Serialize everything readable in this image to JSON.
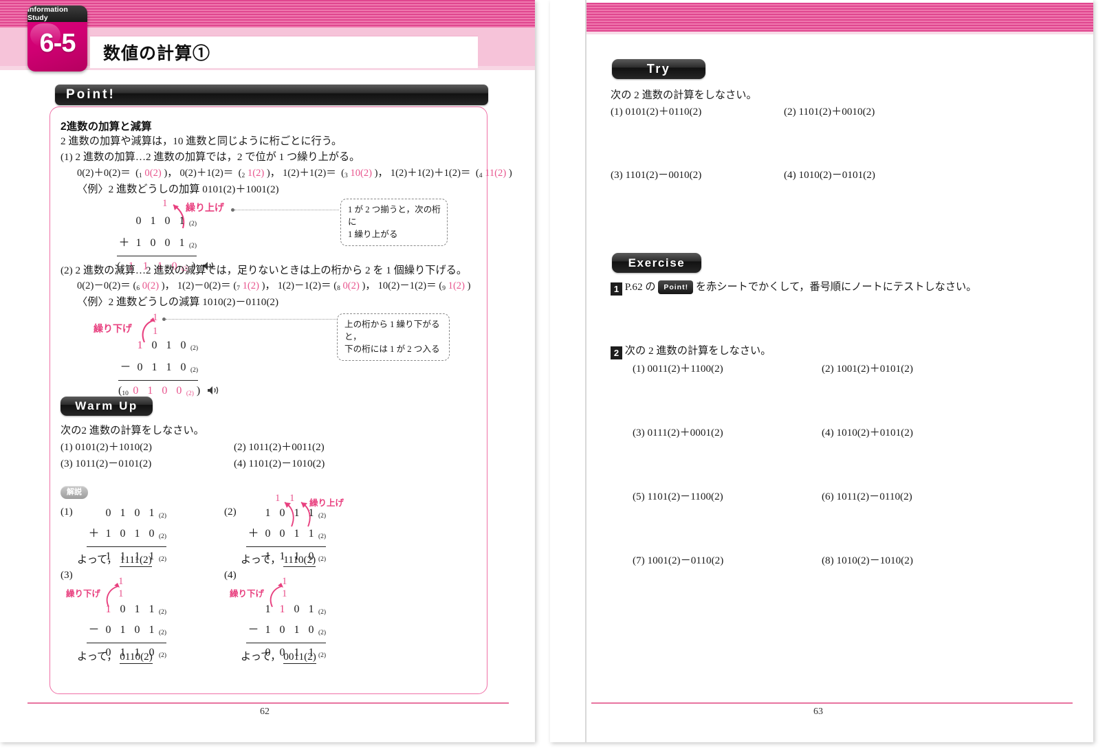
{
  "chapter": {
    "badge_label": "Information Study",
    "number": "6-5",
    "title": "数値の計算①"
  },
  "left_page": {
    "page_number": "62",
    "point_heading": "Point!",
    "point": {
      "section_title": "2進数の加算と減算",
      "intro": "2 進数の加算や減算は，10 進数と同じように桁ごとに行う。",
      "add": {
        "lead": "(1) 2 進数の加算…2 進数の加算では，2 で位が 1 つ繰り上がる。",
        "facts": [
          {
            "lhs": "0(2)＋0(2)＝",
            "blank_no": "1",
            "answer": "0(2)"
          },
          {
            "lhs": "0(2)＋1(2)＝",
            "blank_no": "2",
            "answer": "1(2)"
          },
          {
            "lhs": "1(2)＋1(2)＝",
            "blank_no": "3",
            "answer": "10(2)"
          },
          {
            "lhs": "1(2)＋1(2)＋1(2)＝",
            "blank_no": "4",
            "answer": "11(2)"
          }
        ],
        "example_label": "〈例〉2 進数どうしの加算 0101(2)＋1001(2)",
        "carry_label": "繰り上げ",
        "carry_mark": "1",
        "operand1": [
          "0",
          "1",
          "0",
          "1"
        ],
        "operand2": [
          "1",
          "0",
          "0",
          "1"
        ],
        "op_sign": "＋",
        "result_blank_no": "5",
        "result": [
          "1",
          "1",
          "1",
          "0"
        ],
        "callout": "1 が 2 つ揃うと，次の桁に\n1 繰り上がる"
      },
      "sub": {
        "lead": "(2) 2 進数の減算…2 進数の減算では，足りないときは上の桁から 2 を 1 個繰り下げる。",
        "facts": [
          {
            "lhs": "0(2)－0(2)＝",
            "blank_no": "6",
            "answer": "0(2)"
          },
          {
            "lhs": "1(2)－0(2)＝",
            "blank_no": "7",
            "answer": "1(2)"
          },
          {
            "lhs": "1(2)－1(2)＝",
            "blank_no": "8",
            "answer": "0(2)"
          },
          {
            "lhs": "10(2)－1(2)＝",
            "blank_no": "9",
            "answer": "1(2)"
          }
        ],
        "example_label": "〈例〉2 進数どうしの減算 1010(2)－0110(2)",
        "borrow_label": "繰り下げ",
        "borrow_marks": [
          "1",
          "1"
        ],
        "operand1": [
          "1",
          "0",
          "1",
          "0"
        ],
        "operand2": [
          "0",
          "1",
          "1",
          "0"
        ],
        "op_sign": "－",
        "result_blank_no": "10",
        "result": [
          "0",
          "1",
          "0",
          "0"
        ],
        "callout": "上の桁から 1 繰り下がると，\n下の桁には 1 が 2 つ入る"
      }
    },
    "warmup": {
      "heading": "Warm Up",
      "instruction": "次の2 進数の計算をしなさい。",
      "problems": [
        {
          "no": "(1)",
          "text": "0101(2)＋1010(2)"
        },
        {
          "no": "(2)",
          "text": "1011(2)＋0011(2)"
        },
        {
          "no": "(3)",
          "text": "1011(2)－0101(2)"
        },
        {
          "no": "(4)",
          "text": "1101(2)－1010(2)"
        }
      ]
    },
    "solutions": {
      "badge": "解説",
      "items": [
        {
          "no": "(1)",
          "operand1": [
            "0",
            "1",
            "0",
            "1"
          ],
          "operand2": [
            "1",
            "0",
            "1",
            "0"
          ],
          "op_sign": "＋",
          "result": [
            "1",
            "1",
            "1",
            "1"
          ],
          "conclusion_prefix": "よって，",
          "conclusion_value": "1111(2)",
          "annotation": "",
          "marks": []
        },
        {
          "no": "(2)",
          "operand1": [
            "1",
            "0",
            "1",
            "1"
          ],
          "operand2": [
            "0",
            "0",
            "1",
            "1"
          ],
          "op_sign": "＋",
          "result": [
            "1",
            "1",
            "1",
            "0"
          ],
          "conclusion_prefix": "よって，",
          "conclusion_value": "1110(2)",
          "annotation": "繰り上げ",
          "marks": [
            "1",
            "1"
          ]
        },
        {
          "no": "(3)",
          "operand1": [
            "1",
            "0",
            "1",
            "1"
          ],
          "operand2": [
            "0",
            "1",
            "0",
            "1"
          ],
          "op_sign": "－",
          "result": [
            "0",
            "1",
            "1",
            "0"
          ],
          "conclusion_prefix": "よって，",
          "conclusion_value": "0110(2)",
          "annotation": "繰り下げ",
          "marks": [
            "1",
            "1"
          ]
        },
        {
          "no": "(4)",
          "operand1": [
            "1",
            "1",
            "0",
            "1"
          ],
          "operand2": [
            "1",
            "0",
            "1",
            "0"
          ],
          "op_sign": "－",
          "result": [
            "0",
            "0",
            "1",
            "1"
          ],
          "conclusion_prefix": "よって，",
          "conclusion_value": "0011(2)",
          "annotation": "繰り下げ",
          "marks": [
            "1",
            "1"
          ]
        }
      ]
    }
  },
  "right_page": {
    "page_number": "63",
    "try": {
      "heading": "Try",
      "instruction": "次の 2 進数の計算をしなさい。",
      "problems": [
        {
          "no": "(1)",
          "text": "0101(2)＋0110(2)"
        },
        {
          "no": "(2)",
          "text": "1101(2)＋0010(2)"
        },
        {
          "no": "(3)",
          "text": "1101(2)－0010(2)"
        },
        {
          "no": "(4)",
          "text": "1010(2)－0101(2)"
        }
      ]
    },
    "exercise": {
      "heading": "Exercise",
      "item1": {
        "number": "1",
        "prefix": "P.62 の",
        "point_chip": "Point!",
        "suffix": "を赤シートでかくして，番号順にノートにテストしなさい。"
      },
      "item2": {
        "number": "2",
        "instruction": "次の 2 進数の計算をしなさい。",
        "problems": [
          {
            "no": "(1)",
            "text": "0011(2)＋1100(2)"
          },
          {
            "no": "(2)",
            "text": "1001(2)＋0101(2)"
          },
          {
            "no": "(3)",
            "text": "0111(2)＋0001(2)"
          },
          {
            "no": "(4)",
            "text": "1010(2)＋0101(2)"
          },
          {
            "no": "(5)",
            "text": "1101(2)－1100(2)"
          },
          {
            "no": "(6)",
            "text": "1011(2)－0110(2)"
          },
          {
            "no": "(7)",
            "text": "1001(2)－0110(2)"
          },
          {
            "no": "(8)",
            "text": "1010(2)－1010(2)"
          }
        ]
      }
    }
  },
  "colors": {
    "brand_pink": "#e2007f",
    "accent_pink": "#e8558e",
    "band_pink": "#e0468f",
    "box_border": "#ef6fa6"
  }
}
